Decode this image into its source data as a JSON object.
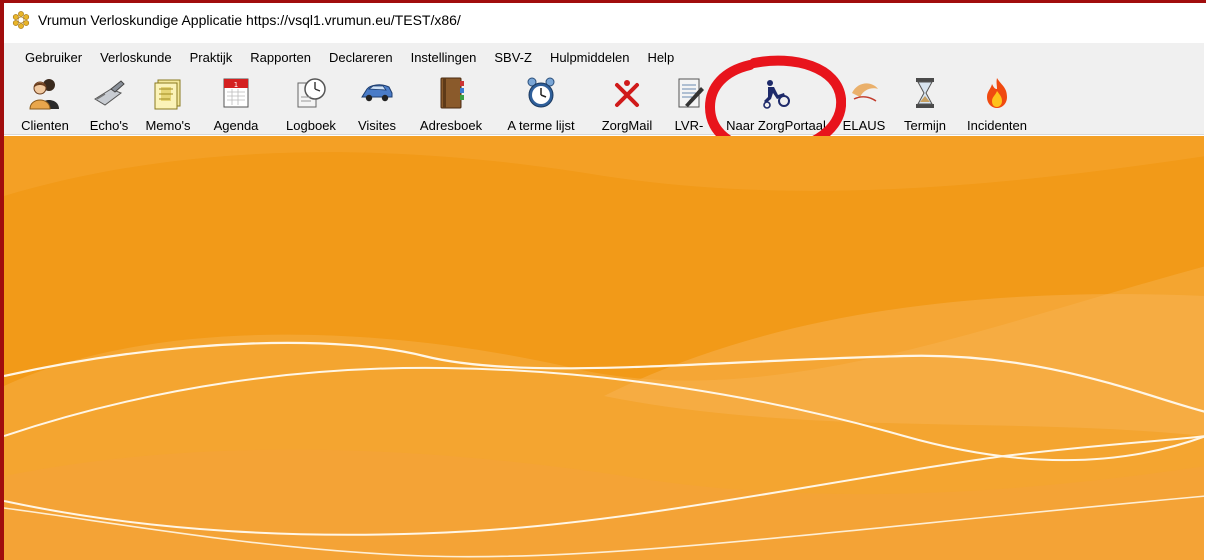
{
  "window": {
    "title": "Vrumun Verloskundige Applicatie https://vsql1.vrumun.eu/TEST/x86/"
  },
  "menu": {
    "items": [
      {
        "label": "Gebruiker"
      },
      {
        "label": "Verloskunde"
      },
      {
        "label": "Praktijk"
      },
      {
        "label": "Rapporten"
      },
      {
        "label": "Declareren"
      },
      {
        "label": "Instellingen"
      },
      {
        "label": "SBV-Z"
      },
      {
        "label": "Hulpmiddelen"
      },
      {
        "label": "Help"
      }
    ]
  },
  "toolbar": {
    "items": [
      {
        "label": "Clienten",
        "icon": "users-icon"
      },
      {
        "label": "Echo's",
        "icon": "ultrasound-icon"
      },
      {
        "label": "Memo's",
        "icon": "memo-icon"
      },
      {
        "label": "Agenda",
        "icon": "calendar-icon"
      },
      {
        "label": "Logboek",
        "icon": "clock-document-icon"
      },
      {
        "label": "Visites",
        "icon": "car-icon"
      },
      {
        "label": "Adresboek",
        "icon": "address-book-icon"
      },
      {
        "label": "A terme lijst",
        "icon": "alarm-clock-icon"
      },
      {
        "label": "ZorgMail",
        "icon": "zorgmail-icon"
      },
      {
        "label": "LVR-",
        "icon": "document-pen-icon"
      },
      {
        "label": "Naar ZorgPortaal",
        "icon": "zorgportaal-icon"
      },
      {
        "label": "ELAUS",
        "icon": "elaus-icon"
      },
      {
        "label": "Termijn",
        "icon": "hourglass-icon"
      },
      {
        "label": "Incidenten",
        "icon": "fire-icon"
      }
    ]
  },
  "annotation": {
    "type": "red-circle",
    "target": "Naar ZorgPortaal",
    "color": "#e8141c"
  },
  "theme": {
    "background_orange": "#f29a18",
    "accent_red": "#a10d0d"
  }
}
